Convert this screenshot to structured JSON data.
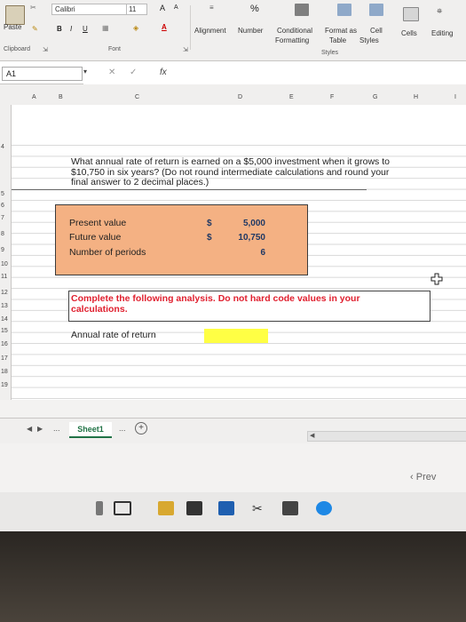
{
  "ribbon": {
    "paste_label": "Paste",
    "clipboard_label": "Clipboard",
    "font_name": "Calibri",
    "font_size": "11",
    "bold": "B",
    "italic": "I",
    "underline": "U",
    "grow_font": "A",
    "shrink_font": "A",
    "font_label": "Font",
    "alignment_label": "Alignment",
    "number_label": "Number",
    "number_icon": "%",
    "conditional_label_1": "Conditional",
    "conditional_label_2": "Formatting",
    "format_table_1": "Format as",
    "format_table_2": "Table",
    "cell_styles_1": "Cell",
    "cell_styles_2": "Styles",
    "styles_label": "Styles",
    "cells_label": "Cells",
    "editing_label": "Editing"
  },
  "formula_bar": {
    "name_box": "A1",
    "cancel": "✕",
    "enter": "✓",
    "fx": "fx"
  },
  "columns": [
    "A",
    "B",
    "C",
    "D",
    "E",
    "F",
    "G",
    "H",
    "I"
  ],
  "rows": [
    "4",
    "5",
    "6",
    "7",
    "8",
    "9",
    "10",
    "11",
    "12",
    "13",
    "14",
    "15",
    "16",
    "17",
    "18",
    "19"
  ],
  "question": "What annual rate of return is earned on a $5,000 investment when it grows to $10,750 in six years? (Do not round intermediate calculations and round your final answer to 2 decimal places.)",
  "inputs": [
    {
      "label": "Present value",
      "currency": "$",
      "value": "5,000"
    },
    {
      "label": "Future value",
      "currency": "$",
      "value": "10,750"
    },
    {
      "label": "Number of periods",
      "currency": "",
      "value": "6"
    }
  ],
  "instruction": "Complete the following analysis. Do not hard code values in your calculations.",
  "answer_label": "Annual rate of return",
  "sheet_tab": "Sheet1",
  "sheet_more": "...",
  "prev_label": "Prev",
  "colors": {
    "input_fill": "#f4b183",
    "instruction_red": "#e0202f",
    "answer_fill": "#ffff44",
    "excel_green": "#217346"
  }
}
